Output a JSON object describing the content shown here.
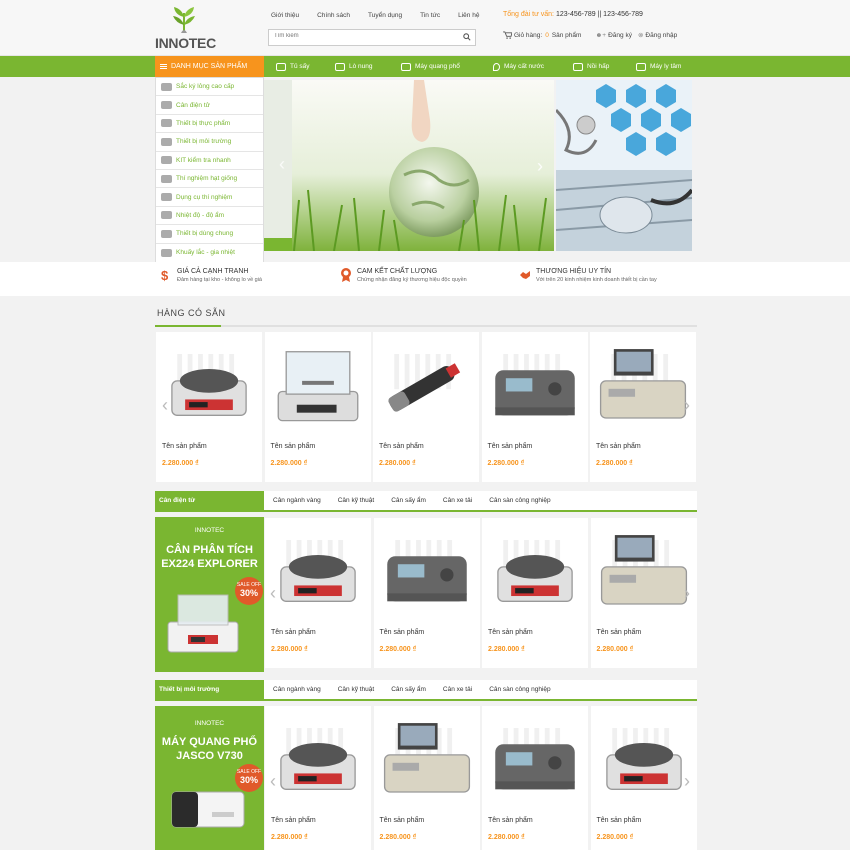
{
  "brand": {
    "name": "INNOTEC"
  },
  "topnav": [
    "Giới thiệu",
    "Chính sách",
    "Tuyển dụng",
    "Tin tức",
    "Liên hệ"
  ],
  "search": {
    "placeholder": "Tìm kiếm"
  },
  "hotline": {
    "label": "Tổng đài tư vấn:",
    "numbers": "123-456-789 || 123-456-789"
  },
  "cart": {
    "label": "Giỏ hàng:",
    "count": "0",
    "unit": "Sản phẩm",
    "register": "Đăng ký",
    "login": "Đăng nhập"
  },
  "mainnav": {
    "category_button": "DANH MỤC SẢN PHẨM",
    "items": [
      "Tủ sấy",
      "Lò nung",
      "Máy quang phổ",
      "Máy cất nước",
      "Nồi hấp",
      "Máy ly tâm"
    ]
  },
  "categories": [
    "Sắc ký lỏng cao cấp",
    "Cân điện tử",
    "Thiết bị thực phẩm",
    "Thiết bị môi trường",
    "KIT kiểm tra nhanh",
    "Thí nghiệm hạt giống",
    "Dụng cụ thí nghiệm",
    "Nhiệt độ - độ ẩm",
    "Thiết bị dùng chung",
    "Khuấy lắc - gia nhiệt"
  ],
  "features": [
    {
      "title": "GIÁ CẢ CẠNH TRANH",
      "sub": "Đảm hàng tại kho - không lo về giá"
    },
    {
      "title": "CAM KẾT CHẤT LƯỢNG",
      "sub": "Chứng nhận đăng ký thương hiệu độc quyền"
    },
    {
      "title": "THƯƠNG HIỆU UY TÍN",
      "sub": "Với trên 20 kinh nhiệm kinh doanh thiết bị cần tay"
    }
  ],
  "sections": {
    "available": {
      "title": "HÀNG CÓ SẴN"
    },
    "scale": {
      "title": "Cân điện tử",
      "tabs": [
        "Cân ngành vàng",
        "Cân kỹ thuật",
        "Cân sấy ẩm",
        "Cân xe tải",
        "Cân sàn công nghiệp"
      ],
      "promo": {
        "brand": "INNOTEC",
        "line1": "CÂN PHÂN TÍCH",
        "line2": "EX224 EXPLORER",
        "badge_top": "SALE OFF",
        "badge_pct": "30%"
      }
    },
    "env": {
      "title": "Thiết bị môi trường",
      "tabs": [
        "Cân ngành vàng",
        "Cân kỹ thuật",
        "Cân sấy ẩm",
        "Cân xe tải",
        "Cân sàn công nghiệp"
      ],
      "promo": {
        "brand": "INNOTEC",
        "line1": "MÁY QUANG PHỔ",
        "line2": "JASCO V730",
        "badge_top": "SALE OFF",
        "badge_pct": "30%"
      }
    }
  },
  "product": {
    "name": "Tên sản phẩm",
    "price": "2.280.000 ₫"
  },
  "colors": {
    "green": "#7ab631",
    "orange": "#f7941d"
  }
}
